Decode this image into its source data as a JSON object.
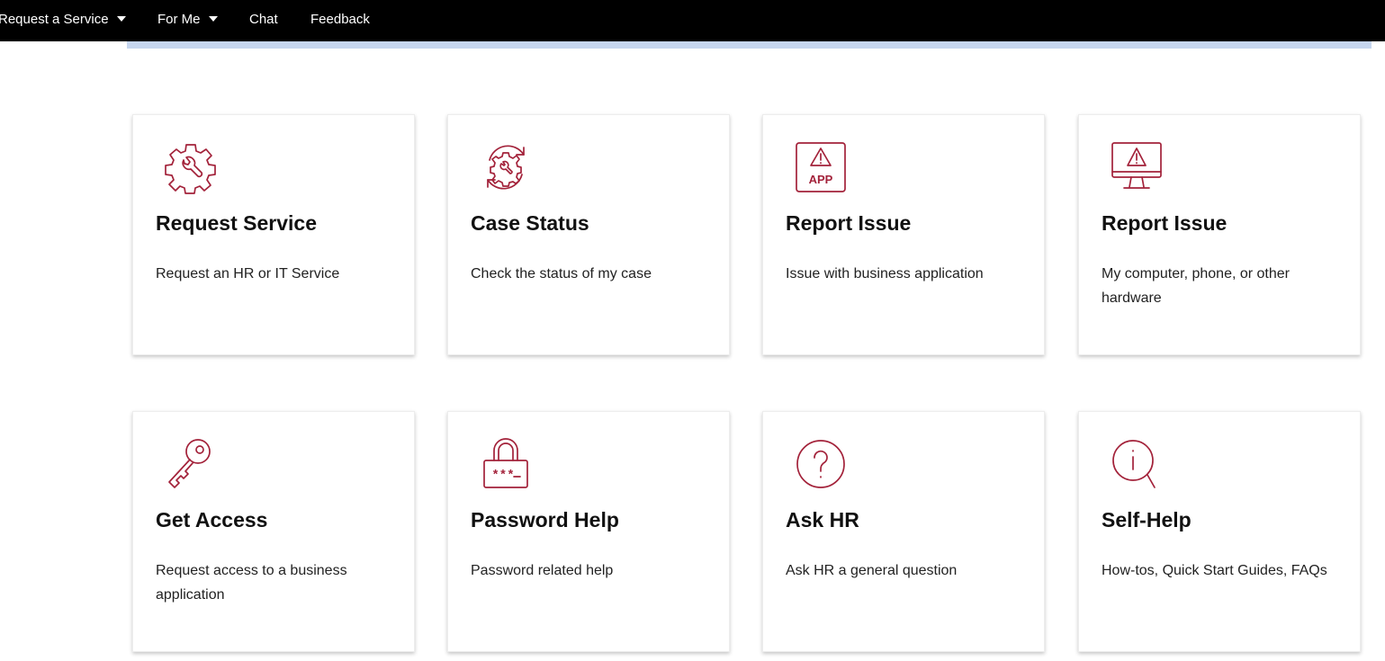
{
  "nav": {
    "request_service": "Request a Service",
    "for_me": "For Me",
    "chat": "Chat",
    "feedback": "Feedback"
  },
  "theme": {
    "nav_bg": "#000000",
    "accent_bar": "#c6d6ef",
    "icon_color": "#a3223a"
  },
  "cards": [
    {
      "title": "Request Service",
      "desc": "Request an HR or IT Service",
      "icon": "gear-wrench-icon"
    },
    {
      "title": "Case Status",
      "desc": "Check the status of my case",
      "icon": "refresh-gear-icon"
    },
    {
      "title": "Report Issue",
      "desc": "Issue with business application",
      "icon": "app-warning-icon"
    },
    {
      "title": "Report Issue",
      "desc": "My computer, phone, or other hardware",
      "icon": "monitor-warning-icon"
    },
    {
      "title": "Get Access",
      "desc": "Request access to a business application",
      "icon": "key-icon"
    },
    {
      "title": "Password Help",
      "desc": "Password related help",
      "icon": "padlock-icon"
    },
    {
      "title": "Ask HR",
      "desc": "Ask HR a general question",
      "icon": "question-icon"
    },
    {
      "title": "Self-Help",
      "desc": "How-tos, Quick Start Guides, FAQs",
      "icon": "info-search-icon"
    }
  ]
}
